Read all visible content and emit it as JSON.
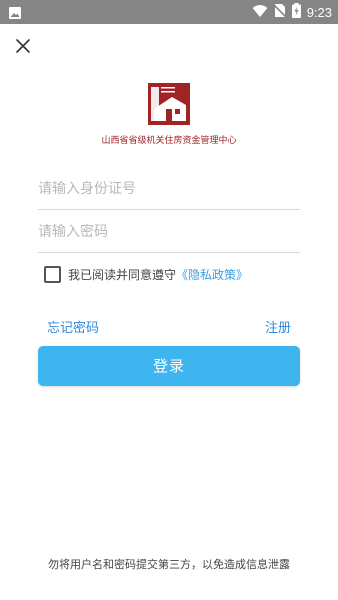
{
  "status_bar": {
    "time": "9:23",
    "icons": [
      "image-notification-icon",
      "wifi-icon",
      "no-sim-icon",
      "battery-charging-icon"
    ]
  },
  "header": {
    "close_icon": "close-icon"
  },
  "logo": {
    "org_name": "山西省省级机关住房资金管理中心",
    "brand_color": "#a02326"
  },
  "form": {
    "id_placeholder": "请输入身份证号",
    "id_value": "",
    "password_placeholder": "请输入密码",
    "password_value": "",
    "agree_text": "我已阅读并同意遵守",
    "policy_link": "《隐私政策》",
    "agreed": false,
    "forgot_label": "忘记密码",
    "register_label": "注册",
    "login_label": "登录"
  },
  "footer": {
    "warning": "勿将用户名和密码提交第三方，以免造成信息泄露"
  },
  "colors": {
    "accent": "#3fb5f0",
    "link": "#2f89d8",
    "status_bar": "#858585"
  }
}
